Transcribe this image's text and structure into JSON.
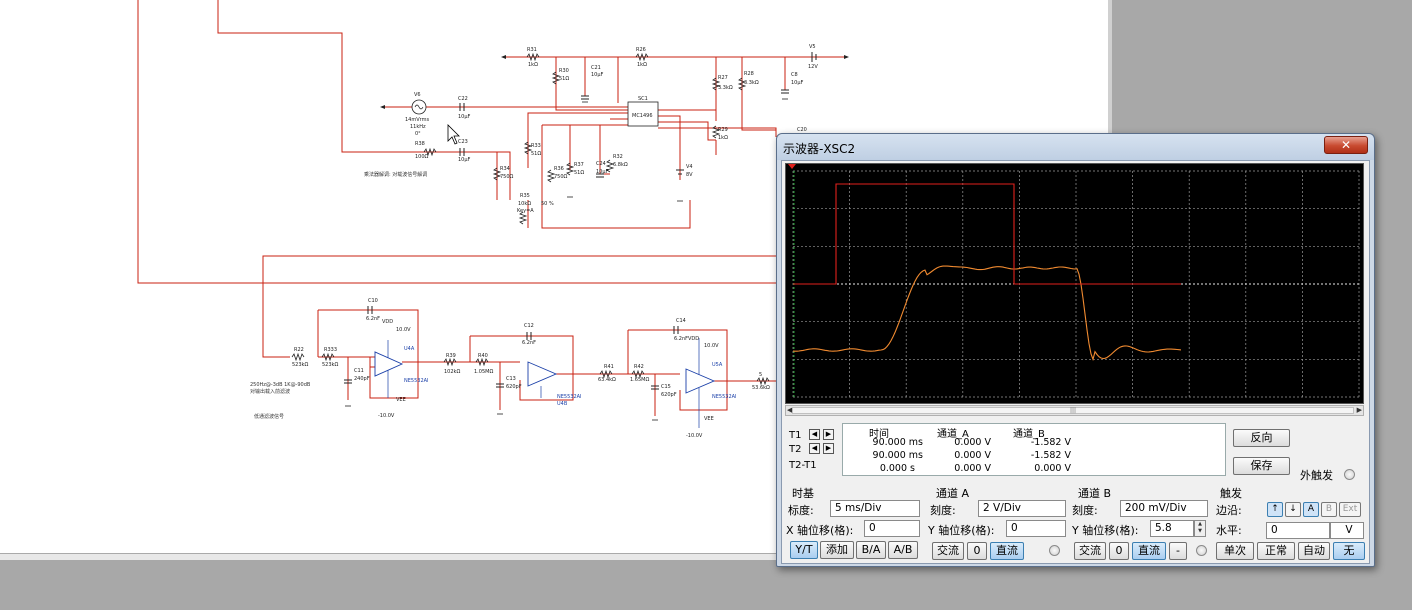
{
  "oscilloscope": {
    "title": "示波器-XSC2",
    "close_label": "✕",
    "measurements": {
      "headers": [
        "时间",
        "通道_A",
        "通道_B"
      ],
      "rows": [
        {
          "label": "T1",
          "time": "90.000 ms",
          "a": "0.000 V",
          "b": "-1.582 V"
        },
        {
          "label": "T2",
          "time": "90.000 ms",
          "a": "0.000 V",
          "b": "-1.582 V"
        },
        {
          "label": "T2-T1",
          "time": "0.000 s",
          "a": "0.000 V",
          "b": "0.000 V"
        }
      ]
    },
    "reverse_label": "反向",
    "save_label": "保存",
    "ext_trigger_label": "外触发",
    "timebase": {
      "title": "时基",
      "scale_label": "标度:",
      "scale_value": "5 ms/Div",
      "xpos_label": "X 轴位移(格):",
      "xpos_value": "0",
      "buttons": [
        "Y/T",
        "添加",
        "B/A",
        "A/B"
      ]
    },
    "channel_a": {
      "title": "通道 A",
      "scale_label": "刻度:",
      "scale_value": "2  V/Div",
      "ypos_label": "Y 轴位移(格):",
      "ypos_value": "0",
      "buttons": [
        "交流",
        "0",
        "直流"
      ]
    },
    "channel_b": {
      "title": "通道 B",
      "scale_label": "刻度:",
      "scale_value": "200 mV/Div",
      "ypos_label": "Y 轴位移(格):",
      "ypos_value": "5.8",
      "buttons": [
        "交流",
        "0",
        "直流",
        "-"
      ]
    },
    "trigger": {
      "title": "触发",
      "edge_label": "边沿:",
      "edge_buttons": [
        "↑",
        "↓",
        "A",
        "B",
        "Ext"
      ],
      "level_label": "水平:",
      "level_value": "0",
      "level_unit": "V",
      "mode_buttons": [
        "单次",
        "正常",
        "自动",
        "无"
      ]
    },
    "colors": {
      "trace_a": "#e0201c",
      "trace_b": "#f08a30",
      "grid": "#9a9a9a",
      "screen": "#000000"
    }
  },
  "schematic": {
    "components": [
      {
        "ref": "R31",
        "value": "1kΩ"
      },
      {
        "ref": "C21",
        "value": "10µF"
      },
      {
        "ref": "R26",
        "value": "1kΩ"
      },
      {
        "ref": "V5",
        "value": "12V"
      },
      {
        "ref": "R30",
        "value": "51Ω"
      },
      {
        "ref": "R27",
        "value": "3.3kΩ"
      },
      {
        "ref": "R28",
        "value": "3.3kΩ"
      },
      {
        "ref": "C8",
        "value": "10µF"
      },
      {
        "ref": "V6",
        "value": "14mVrms",
        "extra": [
          "11kHz",
          "0°"
        ]
      },
      {
        "ref": "C22",
        "value": "10µF"
      },
      {
        "ref": "SC1",
        "value": "MC1496"
      },
      {
        "ref": "R29",
        "value": "1kΩ"
      },
      {
        "ref": "C20",
        "value": ""
      },
      {
        "ref": "R38",
        "value": "100Ω"
      },
      {
        "ref": "C23",
        "value": "10µF"
      },
      {
        "ref": "R33",
        "value": "51Ω"
      },
      {
        "ref": "R34",
        "value": "750Ω"
      },
      {
        "ref": "R36",
        "value": "750Ω"
      },
      {
        "ref": "R37",
        "value": "51Ω"
      },
      {
        "ref": "C24",
        "value": "10µF"
      },
      {
        "ref": "R32",
        "value": "6.8kΩ"
      },
      {
        "ref": "V4",
        "value": "8V"
      },
      {
        "ref": "R35",
        "value": "10kΩ",
        "extra": [
          "Key=A",
          "50 %"
        ]
      },
      {
        "ref": "C10",
        "value": "6.2nF"
      },
      {
        "ref": "R22",
        "value": "523kΩ"
      },
      {
        "ref": "R333",
        "value": "523kΩ"
      },
      {
        "ref": "C11",
        "value": "240pF"
      },
      {
        "ref": "U4A",
        "value": "NE5532AI"
      },
      {
        "ref": "C12",
        "value": "6.2nF"
      },
      {
        "ref": "R39",
        "value": "102kΩ"
      },
      {
        "ref": "R40",
        "value": "1.05MΩ"
      },
      {
        "ref": "C13",
        "value": "620pF"
      },
      {
        "ref": "U4B",
        "value": "NE5532AI"
      },
      {
        "ref": "C14",
        "value": "6.2nF"
      },
      {
        "ref": "R41",
        "value": "63.4kΩ"
      },
      {
        "ref": "R42",
        "value": "1.65MΩ"
      },
      {
        "ref": "C15",
        "value": "620pF"
      },
      {
        "ref": "U5A",
        "value": "NE5532AI"
      },
      {
        "ref": "R5",
        "value": "53.6kΩ"
      }
    ],
    "rails": {
      "vdd": "VDD",
      "vdd_v": "10.0V",
      "vee": "VEE",
      "vee_v": "-10.0V"
    },
    "notes": [
      "乘法器解调: 对载波信号解调",
      "250Hz@-3dB  1K@-90dB",
      "对输出载入前滤波",
      "低通滤波信号"
    ]
  }
}
